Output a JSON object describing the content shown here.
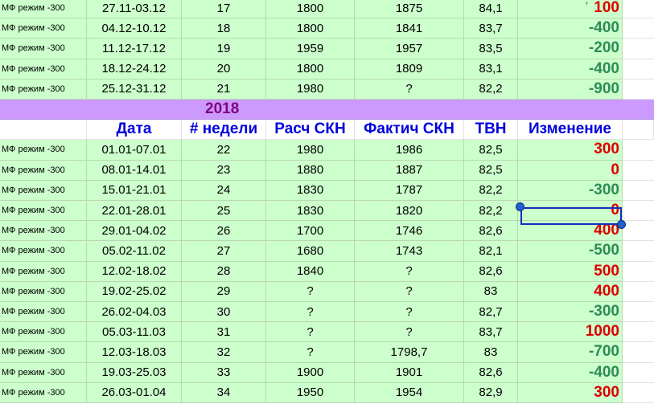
{
  "year": "2018",
  "headers": [
    "",
    "Дата",
    "# недели",
    "Расч СКН",
    "Фактич СКН",
    "ТВН",
    "Изменение"
  ],
  "rows_2017": [
    {
      "mode": "МФ режим -300",
      "date": "27.11-03.12",
      "week": "17",
      "calc": "1800",
      "fact": "1875",
      "tvn": "84,1",
      "change": "100",
      "sign": "pos"
    },
    {
      "mode": "МФ режим -300",
      "date": "04.12-10.12",
      "week": "18",
      "calc": "1800",
      "fact": "1841",
      "tvn": "83,7",
      "change": "-400",
      "sign": "neg"
    },
    {
      "mode": "МФ режим -300",
      "date": "11.12-17.12",
      "week": "19",
      "calc": "1959",
      "fact": "1957",
      "tvn": "83,5",
      "change": "-200",
      "sign": "neg"
    },
    {
      "mode": "МФ режим -300",
      "date": "18.12-24.12",
      "week": "20",
      "calc": "1800",
      "fact": "1809",
      "tvn": "83,1",
      "change": "-400",
      "sign": "neg"
    },
    {
      "mode": "МФ режим -300",
      "date": "25.12-31.12",
      "week": "21",
      "calc": "1980",
      "fact": "?",
      "tvn": "82,2",
      "change": "-900",
      "sign": "neg"
    }
  ],
  "rows_2018": [
    {
      "mode": "МФ режим -300",
      "date": "01.01-07.01",
      "week": "22",
      "calc": "1980",
      "fact": "1986",
      "tvn": "82,5",
      "change": "300",
      "sign": "pos"
    },
    {
      "mode": "МФ режим -300",
      "date": "08.01-14.01",
      "week": "23",
      "calc": "1880",
      "fact": "1887",
      "tvn": "82,5",
      "change": "0",
      "sign": "pos"
    },
    {
      "mode": "МФ режим -300",
      "date": "15.01-21.01",
      "week": "24",
      "calc": "1830",
      "fact": "1787",
      "tvn": "82,2",
      "change": "-300",
      "sign": "neg"
    },
    {
      "mode": "МФ режим -300",
      "date": "22.01-28.01",
      "week": "25",
      "calc": "1830",
      "fact": "1820",
      "tvn": "82,2",
      "change": "0",
      "sign": "pos"
    },
    {
      "mode": "МФ режим -300",
      "date": "29.01-04.02",
      "week": "26",
      "calc": "1700",
      "fact": "1746",
      "tvn": "82,6",
      "change": "400",
      "sign": "pos"
    },
    {
      "mode": "МФ режим -300",
      "date": "05.02-11.02",
      "week": "27",
      "calc": "1680",
      "fact": "1743",
      "tvn": "82,1",
      "change": "-500",
      "sign": "neg"
    },
    {
      "mode": "МФ режим -300",
      "date": "12.02-18.02",
      "week": "28",
      "calc": "1840",
      "fact": "?",
      "tvn": "82,6",
      "change": "500",
      "sign": "pos"
    },
    {
      "mode": "МФ режим -300",
      "date": "19.02-25.02",
      "week": "29",
      "calc": "?",
      "fact": "?",
      "tvn": "83",
      "change": "400",
      "sign": "pos"
    },
    {
      "mode": "МФ режим -300",
      "date": "26.02-04.03",
      "week": "30",
      "calc": "?",
      "fact": "?",
      "tvn": "82,7",
      "change": "-300",
      "sign": "neg"
    },
    {
      "mode": "МФ режим -300",
      "date": "05.03-11.03",
      "week": "31",
      "calc": "?",
      "fact": "?",
      "tvn": "83,7",
      "change": "1000",
      "sign": "pos"
    },
    {
      "mode": "МФ режим -300",
      "date": "12.03-18.03",
      "week": "32",
      "calc": "?",
      "fact": "1798,7",
      "tvn": "83",
      "change": "-700",
      "sign": "neg"
    },
    {
      "mode": "МФ режим -300",
      "date": "19.03-25.03",
      "week": "33",
      "calc": "1900",
      "fact": "1901",
      "tvn": "82,6",
      "change": "-400",
      "sign": "neg"
    },
    {
      "mode": "МФ режим -300",
      "date": "26.03-01.04",
      "week": "34",
      "calc": "1950",
      "fact": "1954",
      "tvn": "82,9",
      "change": "300",
      "sign": "pos"
    }
  ],
  "colors": {
    "cell_bg": "#ccffcc",
    "year_band": "#cc99ff",
    "year_text": "#800080",
    "header_text": "#0000dd",
    "positive": "#dd0000",
    "negative": "#2e8b57",
    "selection": "#1030c0"
  },
  "selected_cell": {
    "date": "22.01-28.01",
    "column": "Изменение"
  }
}
